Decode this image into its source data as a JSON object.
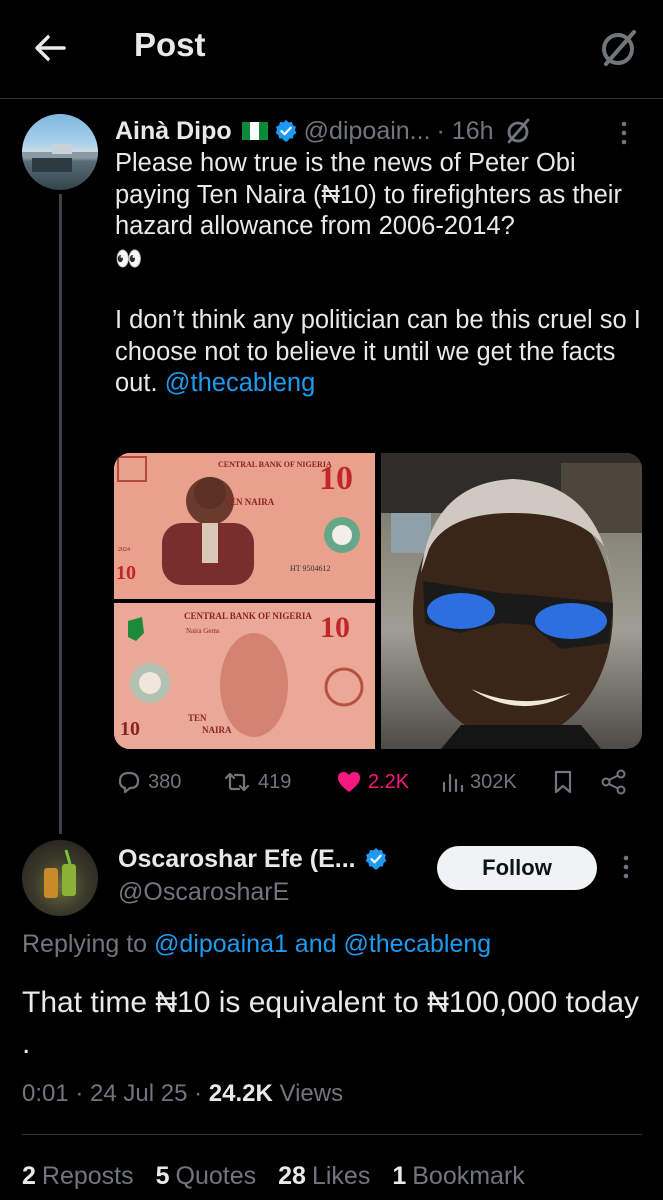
{
  "header": {
    "title": "Post"
  },
  "tweet": {
    "author_name": "Ainà Dipo",
    "handle": "@dipoain...",
    "time": "· 16h",
    "paragraph1": "Please how true is the news of Peter Obi paying Ten Naira (₦10) to firefighters as their hazard allowance from 2006-2014?",
    "emoji": "👀",
    "paragraph2": "I don’t think any politician can be this cruel so I choose not to believe it until we get the facts out.",
    "mention": "@thecableng",
    "banknote": {
      "top_bank": "CENTRAL BANK OF NIGERIA",
      "top_value": "10",
      "ten_naira": "TEN NAIRA",
      "serial": "HT 9504612",
      "bottom_bank": "CENTRAL BANK OF NIGERIA",
      "naira_gems": "Naira Gems",
      "bottom_value": "10",
      "bottom_ten": "TEN",
      "bottom_naira": "NAIRA",
      "side_value": "10",
      "year": "2024"
    },
    "actions": {
      "replies": "380",
      "reposts": "419",
      "likes": "2.2K",
      "views": "302K"
    },
    "colors": {
      "like": "#f91880",
      "link": "#1d9bf0",
      "verified": "#1d9bf0"
    }
  },
  "reply": {
    "author_name": "Oscaroshar Efe (E...",
    "handle": "@OscarosharE",
    "follow_label": "Follow",
    "replying_prefix": "Replying to",
    "replying_to": "@dipoaina1 and @thecableng",
    "text": "That time ₦10 is equivalent to ₦100,000 today .",
    "time": "0:01 · 24 Jul 25 ·",
    "views_count": "24.2K",
    "views_label": "Views",
    "stats": [
      {
        "count": "2",
        "label": "Reposts"
      },
      {
        "count": "5",
        "label": "Quotes"
      },
      {
        "count": "28",
        "label": "Likes"
      },
      {
        "count": "1",
        "label": "Bookmark"
      }
    ]
  }
}
